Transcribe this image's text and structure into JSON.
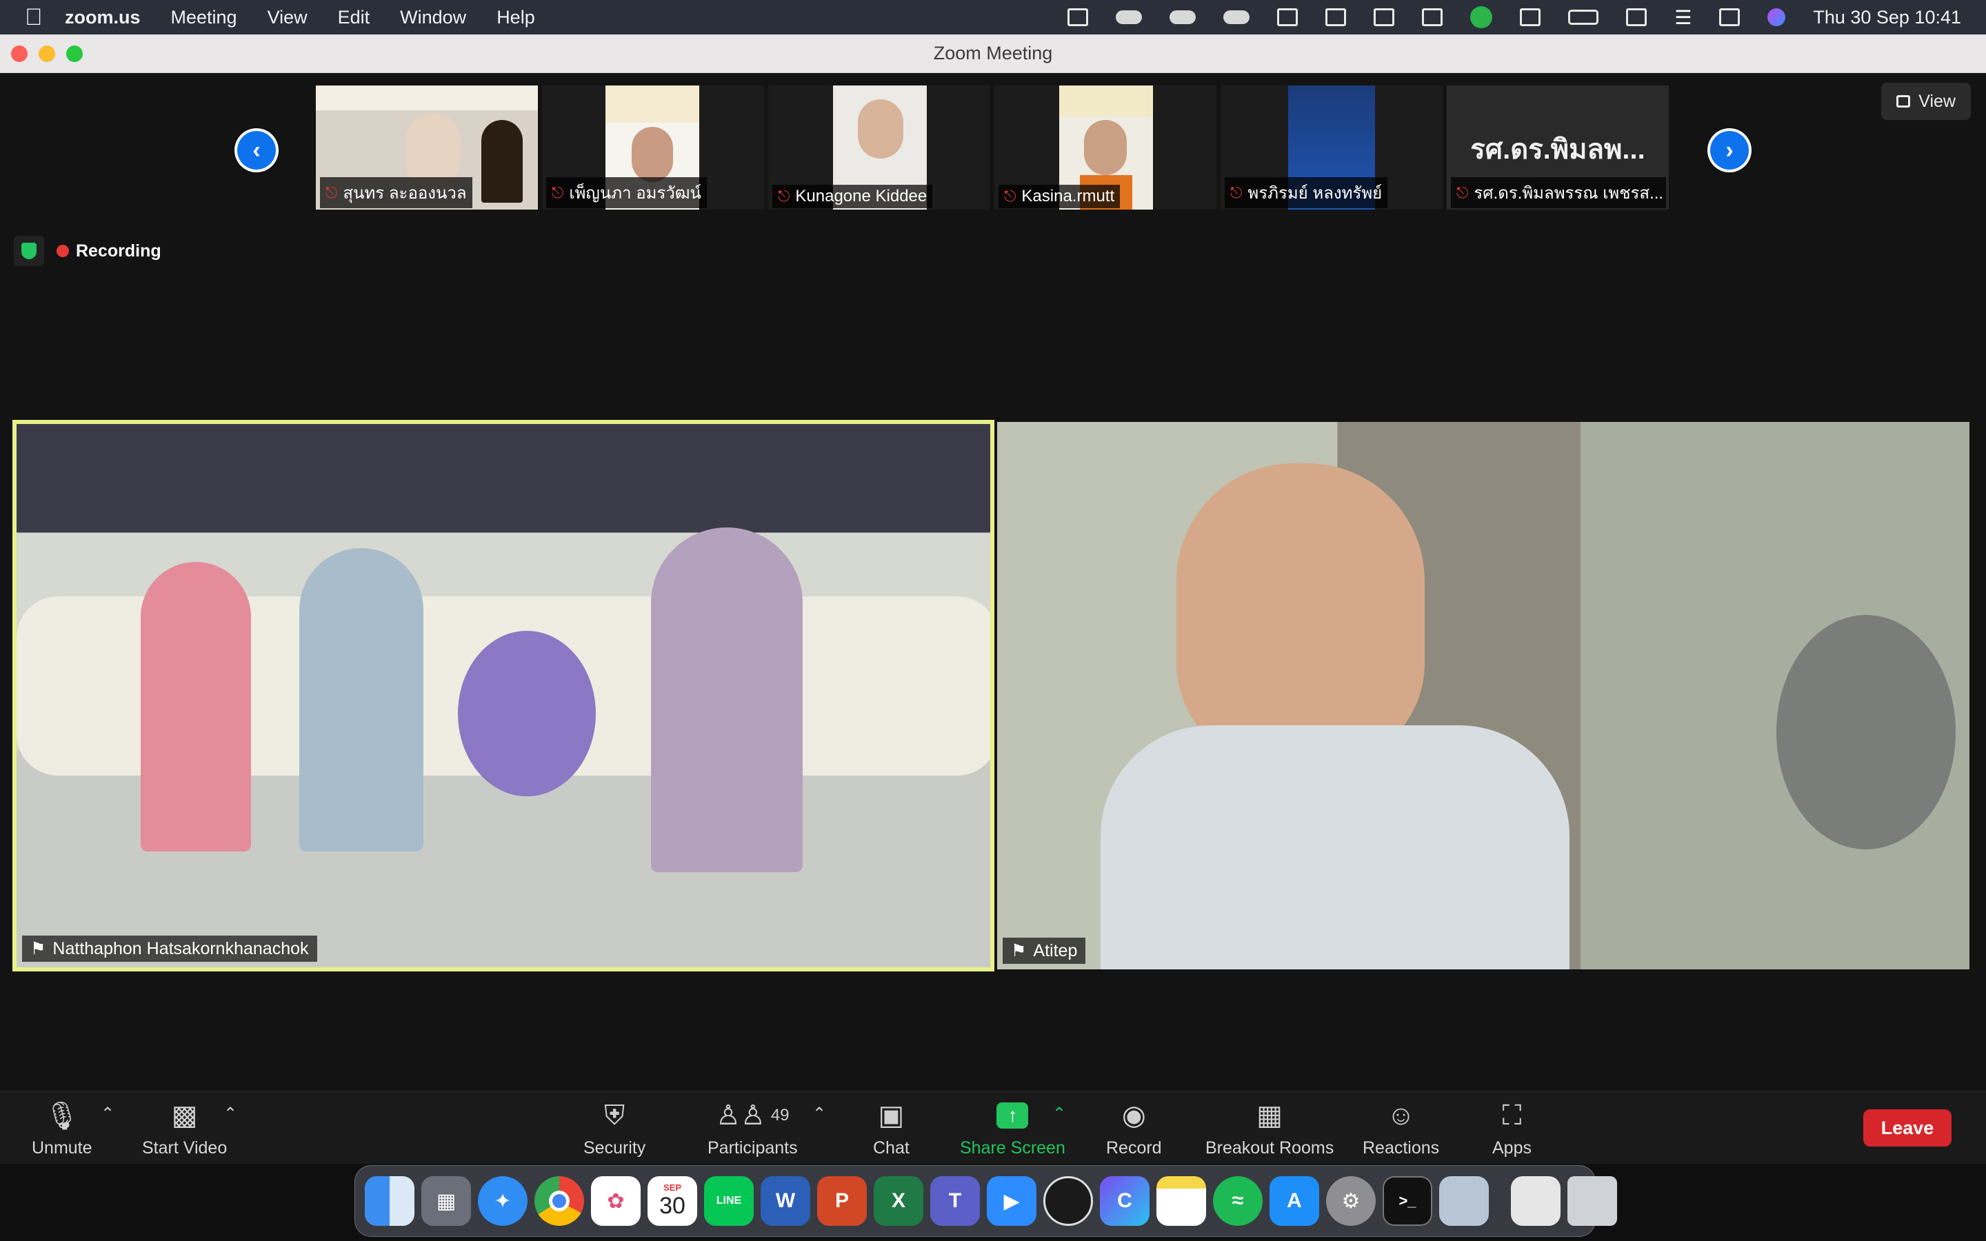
{
  "menubar": {
    "app_name": "zoom.us",
    "menus": [
      "Meeting",
      "View",
      "Edit",
      "Window",
      "Help"
    ],
    "clock": "Thu 30 Sep  10:41"
  },
  "window": {
    "title": "Zoom Meeting"
  },
  "view_button": {
    "label": "View"
  },
  "thumbnails": [
    {
      "name": "สุนทร ละอองนวล"
    },
    {
      "name": "เพ็ญนภา  อมรวัฒน์"
    },
    {
      "name": "Kunagone Kiddee"
    },
    {
      "name": "Kasina.rmutt"
    },
    {
      "name": "พรภิรมย์ หลงทรัพย์"
    },
    {
      "name": "รศ.ดร.พิมลพรรณ เพชรส...",
      "avatar_text": "รศ.ดร.พิมลพ..."
    }
  ],
  "recording": {
    "label": "Recording"
  },
  "tiles": [
    {
      "name": "Natthaphon Hatsakornkhanachok",
      "active_speaker": true
    },
    {
      "name": "Atitep",
      "active_speaker": false
    }
  ],
  "toolbar": {
    "unmute": "Unmute",
    "start_video": "Start Video",
    "security": "Security",
    "participants": "Participants",
    "participants_count": "49",
    "chat": "Chat",
    "share_screen": "Share Screen",
    "record": "Record",
    "breakout_rooms": "Breakout Rooms",
    "reactions": "Reactions",
    "apps": "Apps",
    "leave": "Leave"
  },
  "dock": {
    "calendar_month": "SEP",
    "calendar_day": "30",
    "line_label": "LINE"
  },
  "colors": {
    "zoom_blue": "#0e72ed",
    "leave_red": "#d6262b",
    "share_green": "#22c55e",
    "speaker_highlight": "#e8f08a"
  }
}
